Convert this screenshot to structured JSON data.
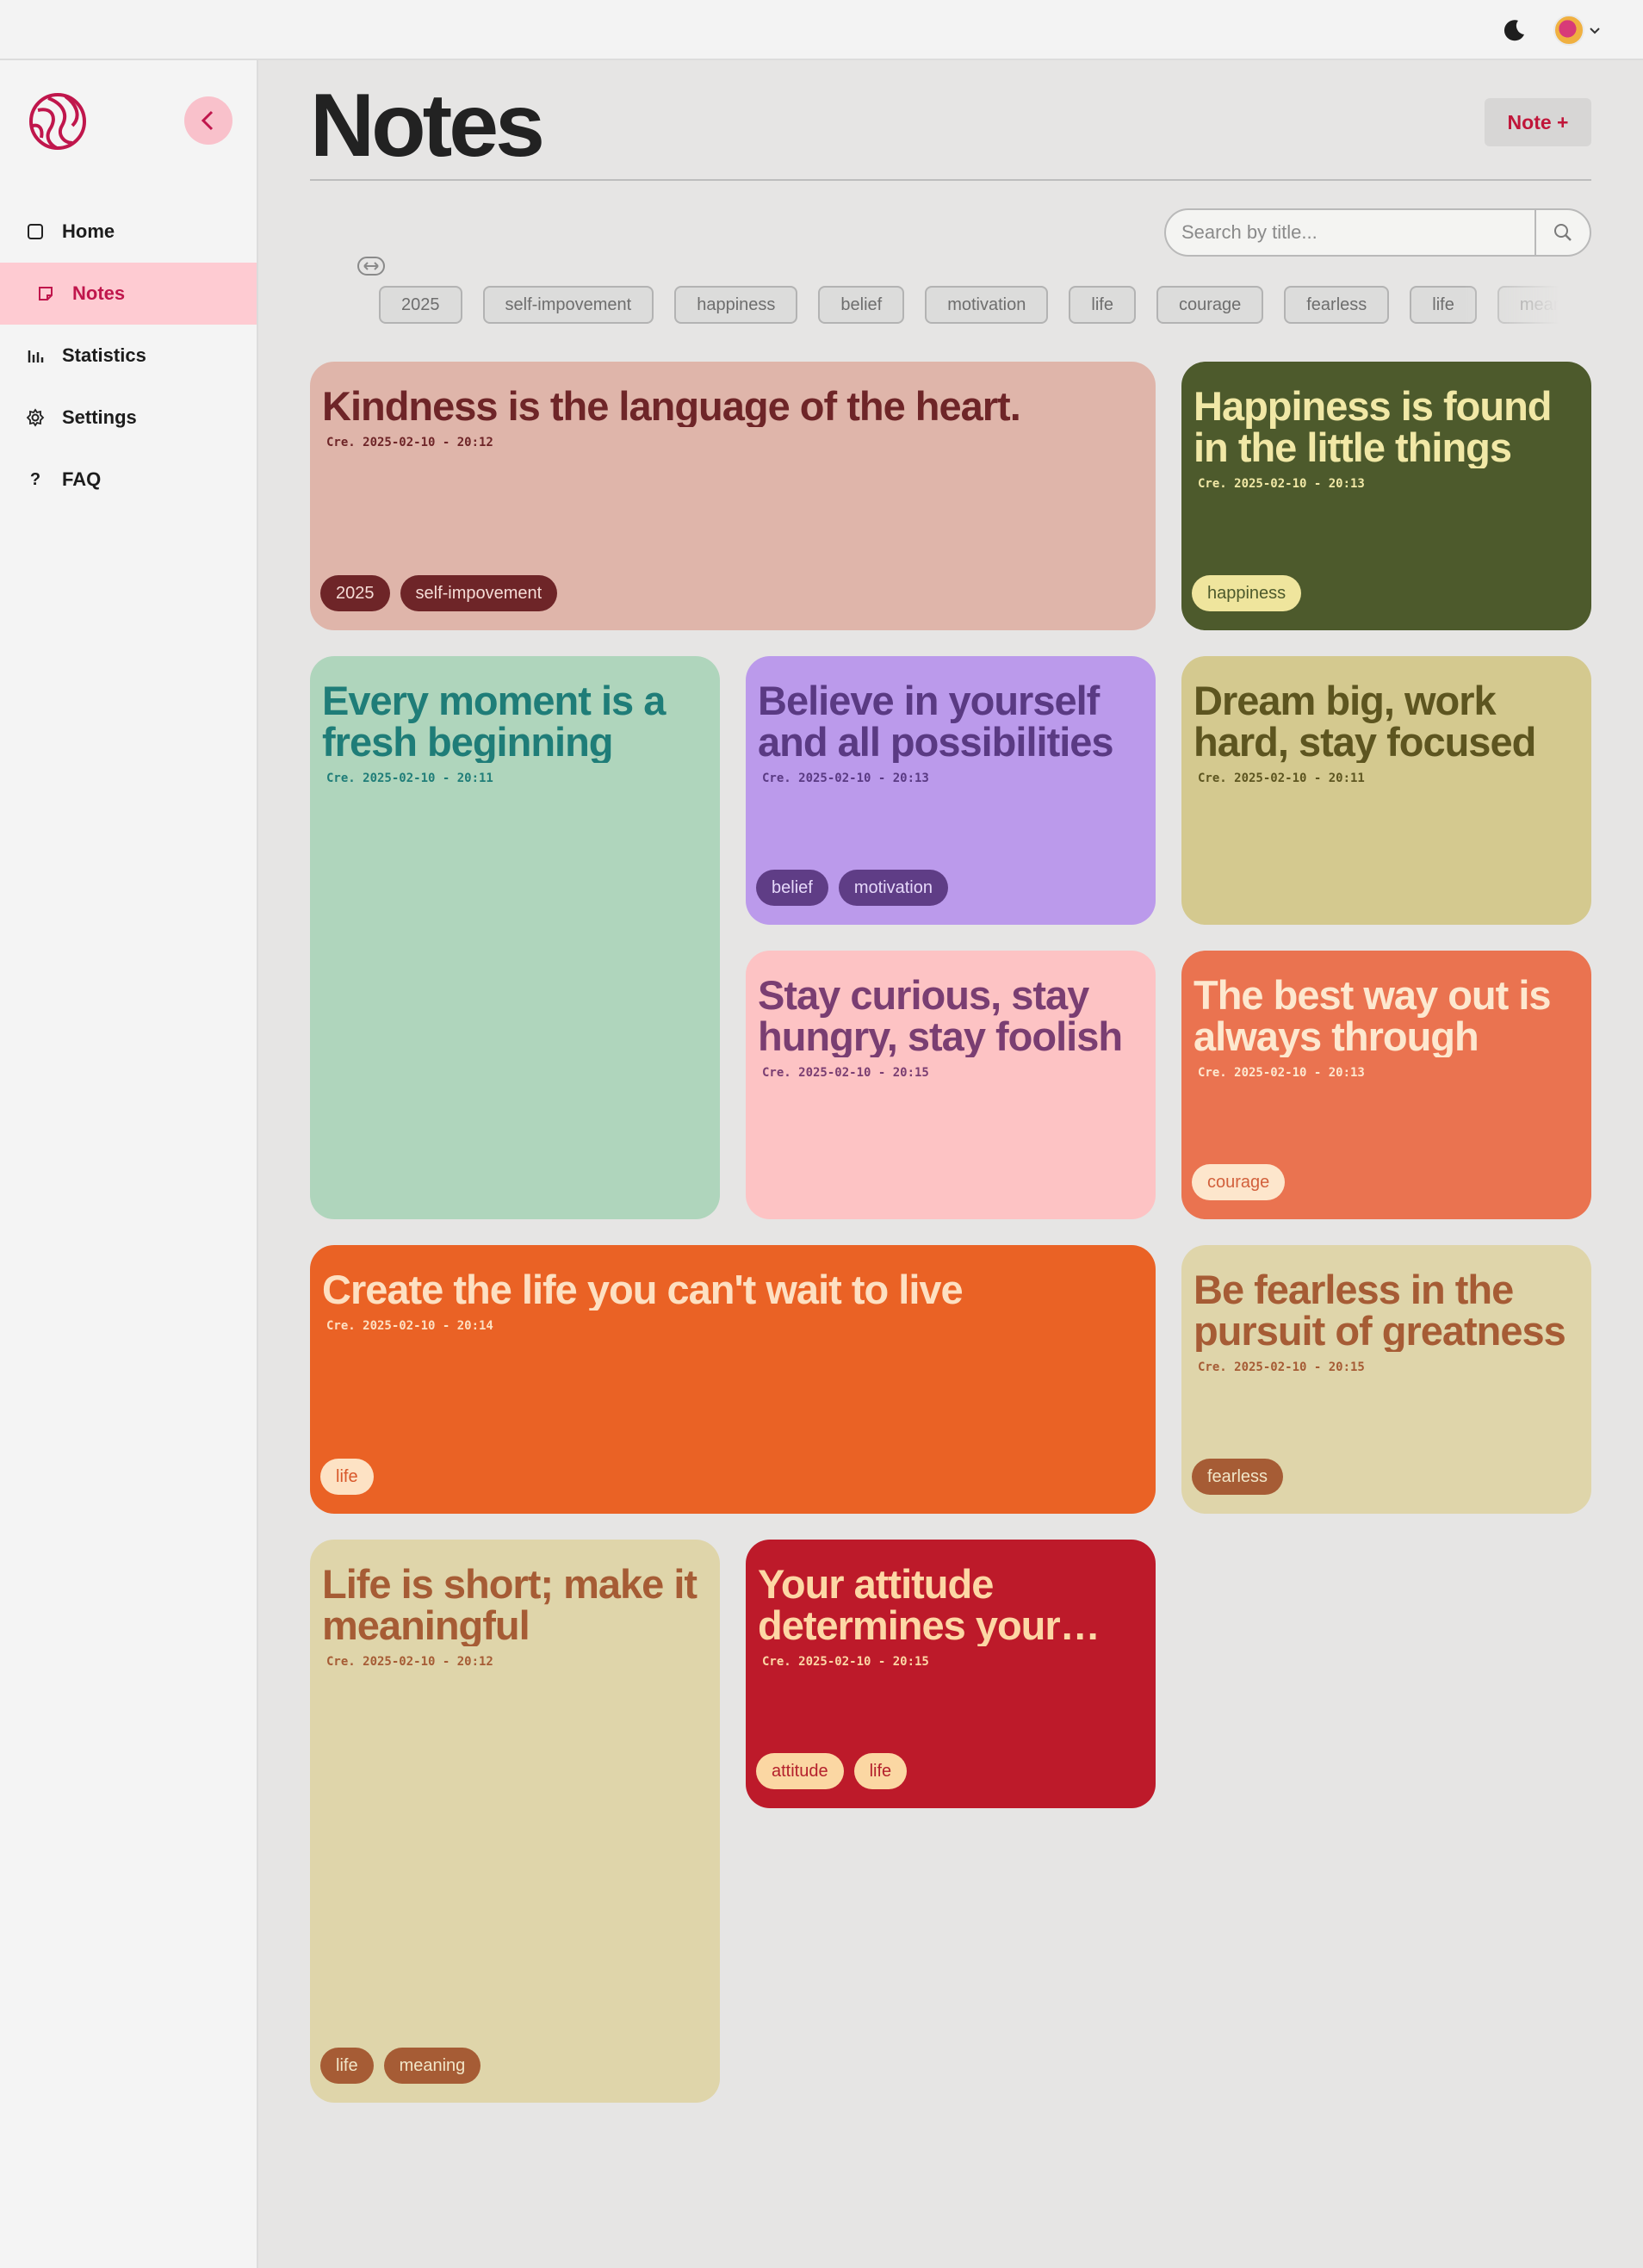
{
  "topbar": {
    "theme_icon": "moon-icon",
    "avatar_icon": "avatar",
    "dropdown_icon": "chevron-down-icon"
  },
  "sidebar": {
    "logo_icon": "globe-logo",
    "collapse_icon": "chevron-left-icon",
    "items": [
      {
        "label": "Home",
        "icon": "square-icon"
      },
      {
        "label": "Notes",
        "icon": "note-icon"
      },
      {
        "label": "Statistics",
        "icon": "bar-chart-icon"
      },
      {
        "label": "Settings",
        "icon": "gear-icon"
      },
      {
        "label": "FAQ",
        "icon": "question-icon"
      }
    ],
    "active_item": "Notes"
  },
  "header": {
    "title": "Notes",
    "new_note_label": "Note +"
  },
  "search": {
    "placeholder": "Search by title...",
    "value": ""
  },
  "tag_filters": [
    "2025",
    "self-impovement",
    "happiness",
    "belief",
    "motivation",
    "life",
    "courage",
    "fearless",
    "life",
    "meaning"
  ],
  "notes": [
    {
      "title": "Kindness is the language of the heart.",
      "date": "Cre. 2025-02-10 - 20:12",
      "tags": [
        "2025",
        "self-impovement"
      ],
      "colors": {
        "bg": "#dfb5aa",
        "text": "#6e2528",
        "tag_bg": "#6e2528",
        "tag_text": "#f5dcd6"
      }
    },
    {
      "title": "Happiness is found in the little things",
      "date": "Cre. 2025-02-10 - 20:13",
      "tags": [
        "happiness"
      ],
      "colors": {
        "bg": "#4d5a2c",
        "text": "#f1e8a6",
        "tag_bg": "#efe59d",
        "tag_text": "#4d5a2c"
      }
    },
    {
      "title": "Every moment is a fresh beginning",
      "date": "Cre. 2025-02-10 - 20:11",
      "tags": [],
      "colors": {
        "bg": "#afd5bc",
        "text": "#1f7d78",
        "tag_bg": "#1f7d78",
        "tag_text": "#afd5bc"
      }
    },
    {
      "title": "Believe in yourself and all possibilities",
      "date": "Cre. 2025-02-10 - 20:13",
      "tags": [
        "belief",
        "motivation"
      ],
      "colors": {
        "bg": "#bb9aeb",
        "text": "#5a3a83",
        "tag_bg": "#5f3d86",
        "tag_text": "#e6d8fa"
      }
    },
    {
      "title": "Dream big, work hard, stay focused",
      "date": "Cre. 2025-02-10 - 20:11",
      "tags": [],
      "colors": {
        "bg": "#d4c98f",
        "text": "#5d5520",
        "tag_bg": "#5d5520",
        "tag_text": "#d4c98f"
      }
    },
    {
      "title": "Stay curious, stay hungry, stay foolish",
      "date": "Cre. 2025-02-10 - 20:15",
      "tags": [],
      "colors": {
        "bg": "#fdc3c4",
        "text": "#7a3e72",
        "tag_bg": "#7a3e72",
        "tag_text": "#fdc3c4"
      }
    },
    {
      "title": "The best way out is always through",
      "date": "Cre. 2025-02-10 - 20:13",
      "tags": [
        "courage"
      ],
      "colors": {
        "bg": "#ea7350",
        "text": "#fde8cf",
        "tag_bg": "#fde6cc",
        "tag_text": "#d2603c"
      }
    },
    {
      "title": "Create the life you can't wait to live",
      "date": "Cre. 2025-02-10 - 20:14",
      "tags": [
        "life"
      ],
      "colors": {
        "bg": "#ea6225",
        "text": "#fde0c2",
        "tag_bg": "#fde2c4",
        "tag_text": "#d8572a"
      }
    },
    {
      "title": "Be fearless in the pursuit of greatness",
      "date": "Cre. 2025-02-10 - 20:15",
      "tags": [
        "fearless"
      ],
      "colors": {
        "bg": "#dfd5aa",
        "text": "#a65c35",
        "tag_bg": "#a65c35",
        "tag_text": "#f1e6c8"
      }
    },
    {
      "title": "Life is short; make it meaningful",
      "date": "Cre. 2025-02-10 - 20:12",
      "tags": [
        "life",
        "meaning"
      ],
      "colors": {
        "bg": "#dfd5aa",
        "text": "#a65c35",
        "tag_bg": "#a65c35",
        "tag_text": "#f1e6c8"
      }
    },
    {
      "title": "Your attitude determines your direction",
      "date": "Cre. 2025-02-10 - 20:15",
      "tags": [
        "attitude",
        "life"
      ],
      "colors": {
        "bg": "#bd1a2a",
        "text": "#fdd7a5",
        "tag_bg": "#fbd7a3",
        "tag_text": "#b4202c"
      }
    }
  ]
}
